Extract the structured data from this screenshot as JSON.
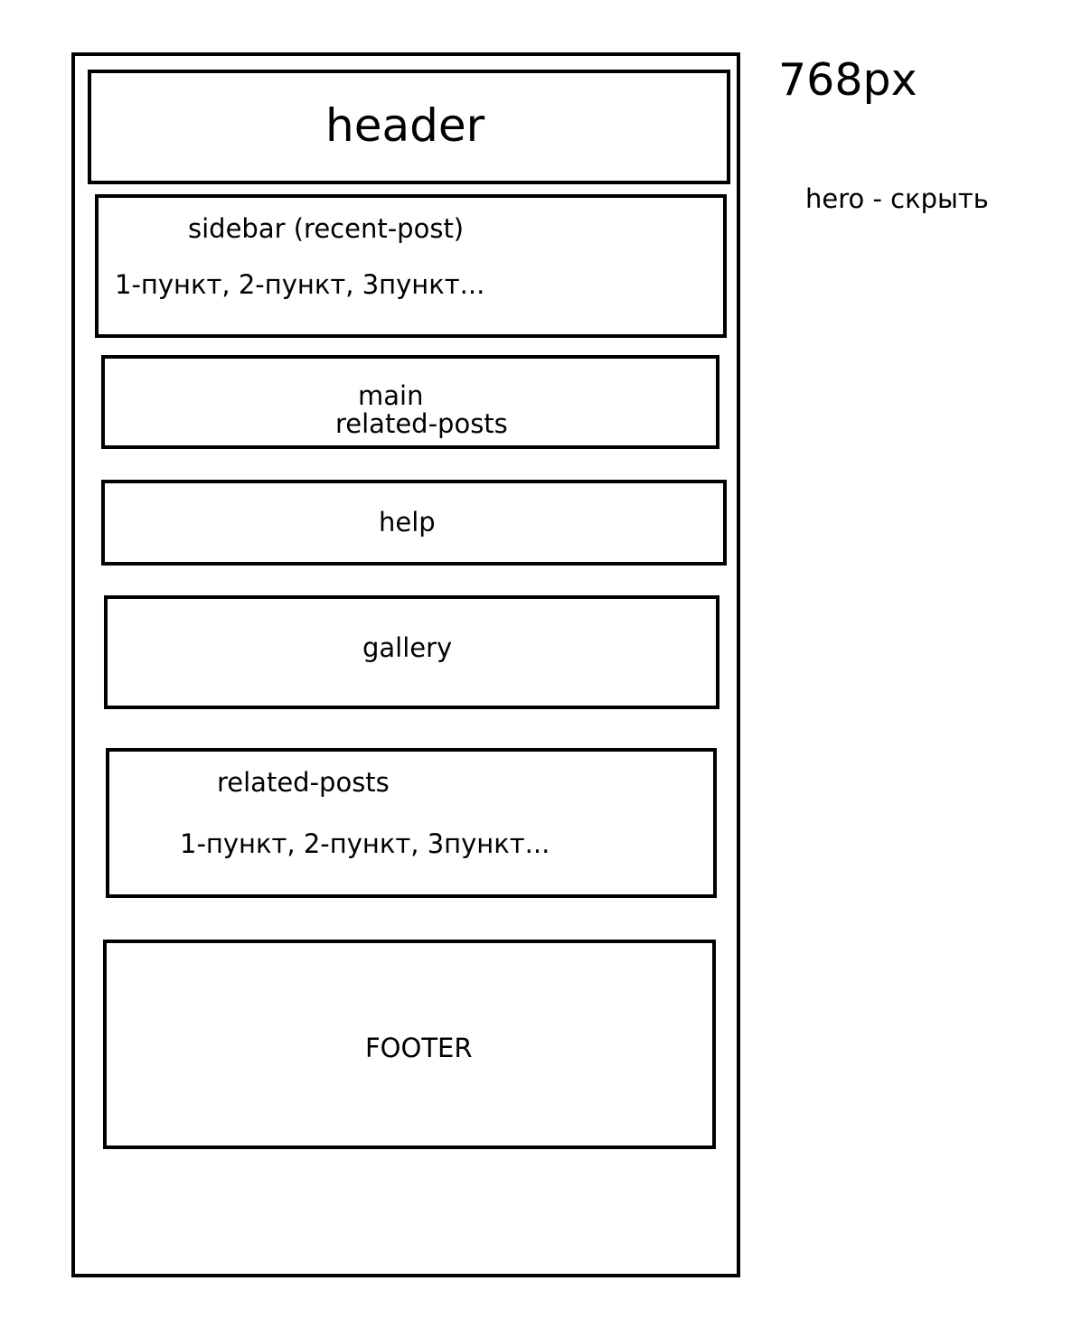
{
  "viewport_label": "768px",
  "note": "hero - скрыть",
  "sections": {
    "header": {
      "label": "header"
    },
    "sidebar": {
      "title": "sidebar (recent-post)",
      "items": "1-пункт, 2-пункт, 3пункт..."
    },
    "main": {
      "label": "main",
      "sublabel": "related-posts"
    },
    "help": {
      "label": "help"
    },
    "gallery": {
      "label": "gallery"
    },
    "related_posts": {
      "title": "related-posts",
      "items": "1-пункт, 2-пункт, 3пункт..."
    },
    "footer": {
      "label": "FOOTER"
    }
  }
}
